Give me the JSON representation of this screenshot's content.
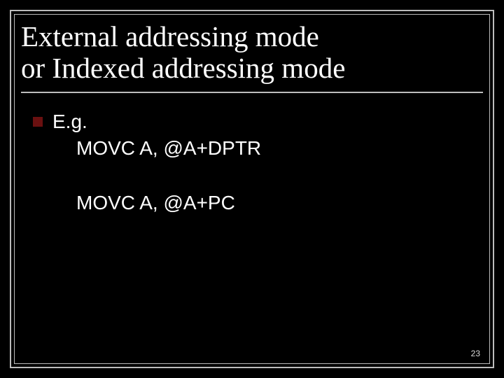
{
  "title_line1": "External addressing mode",
  "title_line2": "or Indexed addressing mode",
  "bullet_label": "E.g.",
  "code_line1": "MOVC A, @A+DPTR",
  "code_line2": "MOVC A, @A+PC",
  "page_number": "23"
}
